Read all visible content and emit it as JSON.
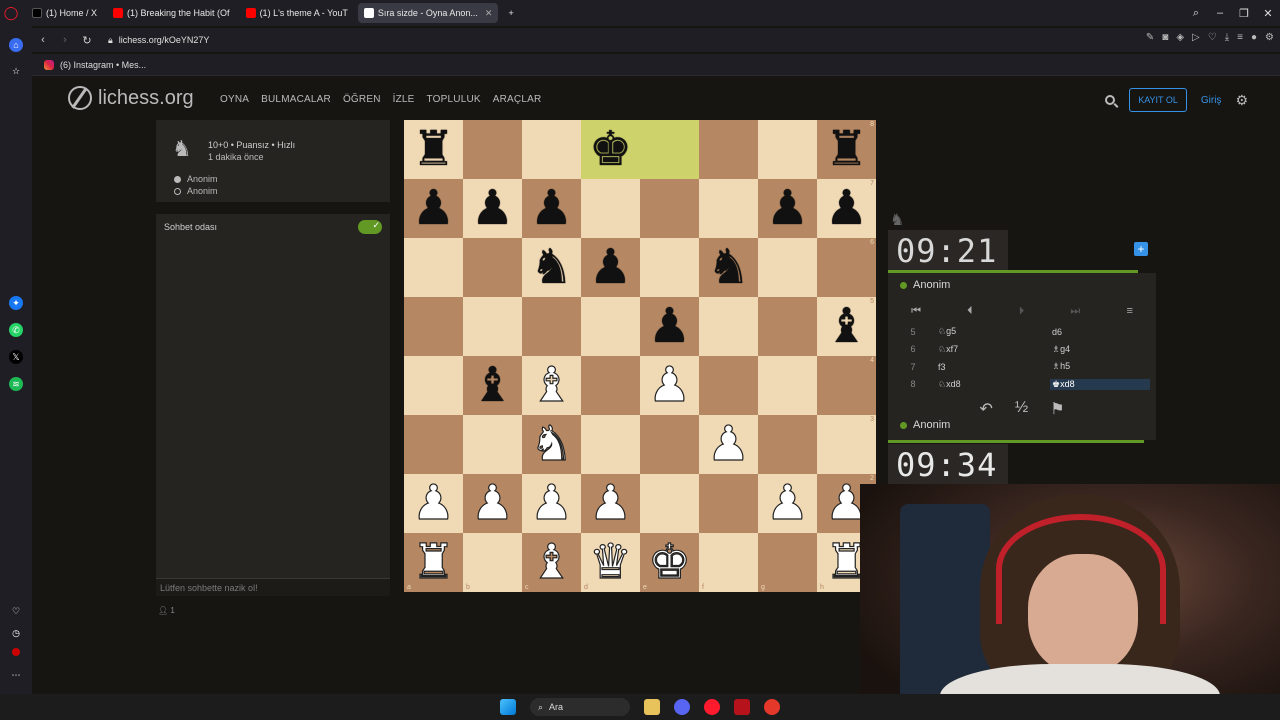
{
  "browser": {
    "tabs": [
      {
        "label": "(1) Home / X",
        "color": "#000000"
      },
      {
        "label": "(1) Breaking the Habit (Of",
        "color": "#ff0000"
      },
      {
        "label": "(1) L's theme A - YouT",
        "color": "#ff0000"
      },
      {
        "label": "Sıra sizde - Oyna Anon...",
        "color": "#ffffff",
        "active": true
      }
    ],
    "new_tab": "+",
    "url": "lichess.org/kOeYN27Y",
    "bookmark": "(6) Instagram • Mes..."
  },
  "site": {
    "logo": "lichess.org",
    "nav": [
      "OYNA",
      "BULMACALAR",
      "ÖĞREN",
      "İZLE",
      "TOPLULUK",
      "ARAÇLAR"
    ],
    "signup": "KAYIT OL",
    "signin": "Giriş"
  },
  "game_info": {
    "mode": "10+0 • Puansız • Hızlı",
    "time_ago": "1 dakika önce",
    "white_player": "Anonim",
    "black_player": "Anonim"
  },
  "chat": {
    "title": "Sohbet odası",
    "placeholder": "Lütfen sohbette nazik ol!",
    "watchers": "1"
  },
  "board": {
    "ranks": [
      [
        "r",
        "",
        "",
        "k",
        "",
        "",
        "",
        "r"
      ],
      [
        "p",
        "p",
        "p",
        "",
        "",
        "",
        "p",
        "p"
      ],
      [
        "",
        "",
        "n",
        "p",
        "",
        "n",
        "",
        ""
      ],
      [
        "",
        "",
        "",
        "",
        "p",
        "",
        "",
        "b"
      ],
      [
        "",
        "b",
        "B",
        "",
        "P",
        "",
        "",
        ""
      ],
      [
        "",
        "",
        "N",
        "",
        "",
        "P",
        "",
        ""
      ],
      [
        "P",
        "P",
        "P",
        "P",
        "",
        "",
        "P",
        "P"
      ],
      [
        "R",
        "",
        "B",
        "Q",
        "K",
        "",
        "",
        "R"
      ]
    ],
    "highlight": [
      [
        0,
        3
      ],
      [
        0,
        4
      ]
    ],
    "files": [
      "a",
      "b",
      "c",
      "d",
      "e",
      "f",
      "g",
      "h"
    ],
    "rank_labels": [
      "8",
      "7",
      "6",
      "5",
      "4",
      "3",
      "2",
      "1"
    ]
  },
  "clocks": {
    "top": "09:21",
    "bottom": "09:34",
    "top_player": "Anonim",
    "bottom_player": "Anonim"
  },
  "moves": [
    {
      "num": "5",
      "white": "♘g5",
      "black": "d6"
    },
    {
      "num": "6",
      "white": "♘xf7",
      "black": "♗g4"
    },
    {
      "num": "7",
      "white": "f3",
      "black": "♗h5"
    },
    {
      "num": "8",
      "white": "♘xd8",
      "black": "♚xd8",
      "current": true
    }
  ],
  "taskbar": {
    "search": "Ara"
  }
}
